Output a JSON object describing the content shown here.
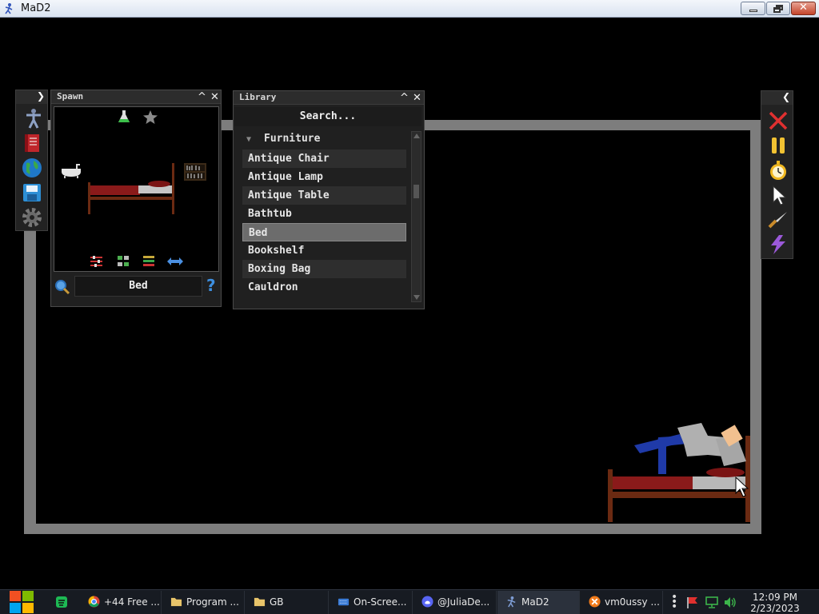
{
  "window": {
    "title": "MaD2"
  },
  "spawn": {
    "title": "Spawn",
    "selected_name": "Bed"
  },
  "library": {
    "title": "Library",
    "search_placeholder": "Search...",
    "category": "Furniture",
    "items": [
      {
        "label": "Antique Chair",
        "selected": false
      },
      {
        "label": "Antique Lamp",
        "selected": false
      },
      {
        "label": "Antique Table",
        "selected": false
      },
      {
        "label": "Bathtub",
        "selected": false
      },
      {
        "label": "Bed",
        "selected": true
      },
      {
        "label": "Bookshelf",
        "selected": false
      },
      {
        "label": "Boxing Bag",
        "selected": false
      },
      {
        "label": "Cauldron",
        "selected": false
      }
    ]
  },
  "taskbar": {
    "items": [
      {
        "label": "+44 Free ...",
        "icon": "chrome-icon"
      },
      {
        "label": "Program ...",
        "icon": "folder-icon"
      },
      {
        "label": "GB",
        "icon": "folder-icon"
      },
      {
        "label": "On-Scree...",
        "icon": "keyboard-icon"
      },
      {
        "label": "@JuliaDe...",
        "icon": "discord-icon"
      },
      {
        "label": "MaD2",
        "icon": "mad2-icon"
      },
      {
        "label": "vm0ussy ...",
        "icon": "x-circle-icon"
      }
    ],
    "clock_time": "12:09 PM",
    "clock_date": "2/23/2023"
  },
  "colors": {
    "arena_wall": "#7d7d7d",
    "bed_frame": "#6b2a12",
    "bed_blanket": "#8a1a1a",
    "ragdoll_pants": "#1f3aa8",
    "ragdoll_shirt": "#b0b0b0",
    "ragdoll_skin": "#f2c08f"
  }
}
